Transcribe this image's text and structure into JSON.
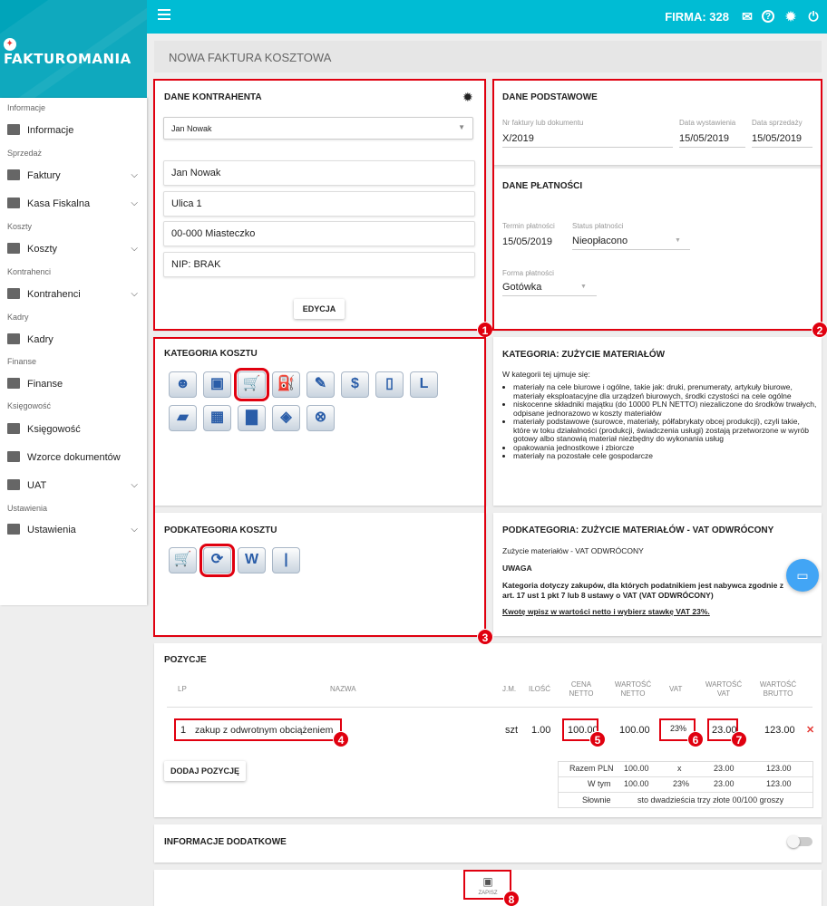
{
  "app": {
    "logo": "FAKTUROMANIA",
    "firma_label": "FIRMA: 328"
  },
  "icons": {
    "menu": "hamburger-icon",
    "mail": "envelope-icon",
    "help": "question-circle-icon",
    "settings": "gear-icon",
    "power": "power-icon"
  },
  "sidebar": {
    "sections": [
      "Informacje",
      "Sprzedaż",
      "Koszty",
      "Kontrahenci",
      "Kadry",
      "Finanse",
      "Księgowość",
      "Ustawienia"
    ],
    "items": [
      "Informacje",
      "Faktury",
      "Kasa Fiskalna",
      "Koszty",
      "Kontrahenci",
      "Kadry",
      "Finanse",
      "Księgowość",
      "Wzorce dokumentów",
      "UAT",
      "Ustawienia"
    ]
  },
  "page_title": "NOWA FAKTURA KOSZTOWA",
  "kontrahent": {
    "title": "DANE KONTRAHENTA",
    "select_value": "Jan Nowak",
    "name": "Jan Nowak",
    "street": "Ulica 1",
    "city": "00-000 Miasteczko",
    "nip": "NIP: BRAK",
    "edit_label": "EDYCJA"
  },
  "podstawowe": {
    "title": "DANE PODSTAWOWE",
    "nr_label": "Nr faktury lub dokumentu",
    "nr_value": "X/2019",
    "data_wyst_label": "Data wystawienia",
    "data_wyst_value": "15/05/2019",
    "data_sprz_label": "Data sprzedaży",
    "data_sprz_value": "15/05/2019"
  },
  "platnosci": {
    "title": "DANE PŁATNOŚCI",
    "termin_label": "Termin płatności",
    "termin_value": "15/05/2019",
    "status_label": "Status płatności",
    "status_value": "Nieopłacono",
    "forma_label": "Forma płatności",
    "forma_value": "Gotówka"
  },
  "kategoria": {
    "title": "KATEGORIA KOSZTU",
    "icons": [
      "robot-icon",
      "box-icon",
      "cart-icon",
      "fuel-icon",
      "wrench-icon",
      "dollar-icon",
      "phone-icon",
      "letter-l-icon",
      "card-icon",
      "cash-register-icon",
      "folder-icon",
      "package-icon",
      "cancel-circle-icon"
    ],
    "glyphs": [
      "☻",
      "▣",
      "🛒",
      "⛽",
      "✎",
      "$",
      "▯",
      "L",
      "▰",
      "▦",
      "▇",
      "◈",
      "⊗"
    ]
  },
  "kategoria_info": {
    "title": "KATEGORIA: ZUŻYCIE MATERIAŁÓW",
    "intro": "W kategorii tej ujmuje się:",
    "bullets": [
      "materiały na cele biurowe i ogólne, takie jak: druki, prenumeraty, artykuły biurowe, materiały eksploatacyjne dla urządzeń biurowych, środki czystości na cele ogólne",
      "niskocenne składniki majątku (do 10000 PLN NETTO) niezaliczone do środków trwałych, odpisane jednorazowo w koszty materiałów",
      "materiały podstawowe (surowce, materiały, półfabrykaty obcej produkcji), czyli takie, które w toku działalności (produkcji, świadczenia usługi) zostają przetworzone w wyrób gotowy albo stanowią materiał niezbędny do wykonania usług",
      "opakowania jednostkowe i zbiorcze",
      "materiały na pozostałe cele gospodarcze"
    ]
  },
  "podkategoria": {
    "title": "PODKATEGORIA KOSZTU",
    "icons": [
      "cart-icon",
      "reverse-arrows-icon",
      "letter-w-icon",
      "letter-i-icon"
    ],
    "glyphs": [
      "🛒",
      "⟳",
      "W",
      "|"
    ]
  },
  "podkategoria_info": {
    "title": "PODKATEGORIA: ZUŻYCIE MATERIAŁÓW - VAT ODWRÓCONY",
    "subtitle": "Zużycie materiałów - VAT ODWRÓCONY",
    "uwaga": "UWAGA",
    "note": "Kategoria dotyczy zakupów, dla których podatnikiem jest nabywca zgodnie z art. 17 ust 1 pkt 7 lub 8 ustawy o VAT (VAT ODWRÓCONY)",
    "hint": "Kwotę wpisz w wartości netto i wybierz stawkę VAT 23%."
  },
  "pozycje": {
    "title": "POZYCJE",
    "headers": [
      "LP",
      "NAZWA",
      "J.M.",
      "ILOŚĆ",
      "CENA NETTO",
      "WARTOŚĆ NETTO",
      "VAT",
      "WARTOŚĆ VAT",
      "WARTOŚĆ BRUTTO"
    ],
    "row": {
      "lp": "1",
      "nazwa": "zakup z odwrotnym obciążeniem",
      "jm": "szt",
      "ilosc": "1.00",
      "cena": "100.00",
      "wart_netto": "100.00",
      "vat": "23%",
      "wart_vat": "23.00",
      "brutto": "123.00"
    },
    "add_label": "DODAJ POZYCJĘ",
    "summary": [
      [
        "Razem PLN",
        "100.00",
        "x",
        "23.00",
        "123.00"
      ],
      [
        "W tym",
        "100.00",
        "23%",
        "23.00",
        "123.00"
      ]
    ],
    "slownie_label": "Słownie",
    "slownie_value": "sto dwadzieścia trzy złote 00/100 groszy"
  },
  "dodatkowe": {
    "title": "INFORMACJE DODATKOWE"
  },
  "save": {
    "label": "ZAPISZ"
  },
  "badges": [
    "1",
    "2",
    "3",
    "4",
    "5",
    "6",
    "7",
    "8"
  ],
  "colors": {
    "topbar": "#00bcd4",
    "highlight": "#e0000f"
  }
}
